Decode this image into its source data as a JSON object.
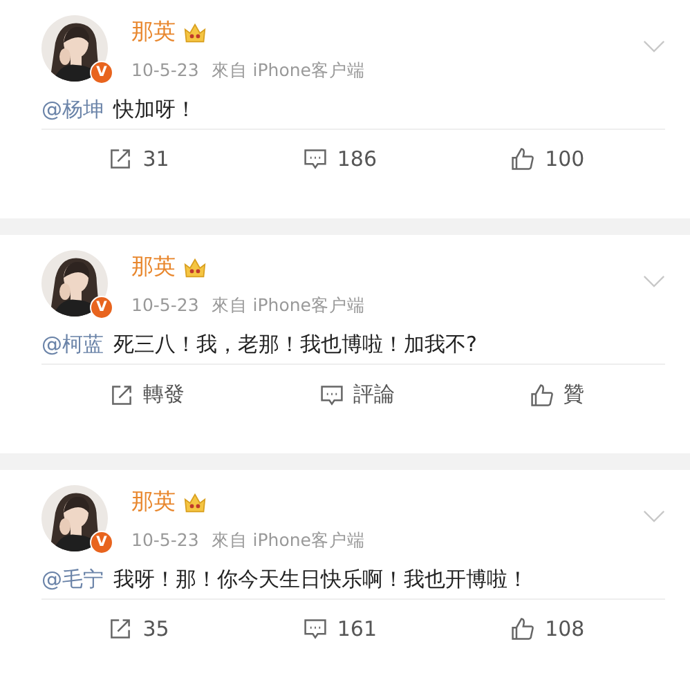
{
  "posts": [
    {
      "author": "那英",
      "verified_badge": "V",
      "time": "10-5-23",
      "source": "來自 iPhone客户端",
      "mention": "@杨坤",
      "text": "快加呀！",
      "actions": [
        {
          "kind": "share",
          "label": "31"
        },
        {
          "kind": "comment",
          "label": "186"
        },
        {
          "kind": "like",
          "label": "100"
        }
      ]
    },
    {
      "author": "那英",
      "verified_badge": "V",
      "time": "10-5-23",
      "source": "來自 iPhone客户端",
      "mention": "@柯蓝",
      "text": "死三八！我，老那！我也博啦！加我不?",
      "actions": [
        {
          "kind": "share",
          "label": "轉發"
        },
        {
          "kind": "comment",
          "label": "評論"
        },
        {
          "kind": "like",
          "label": "贊"
        }
      ]
    },
    {
      "author": "那英",
      "verified_badge": "V",
      "time": "10-5-23",
      "source": "來自 iPhone客户端",
      "mention": "@毛宁",
      "text": "我呀！那！你今天生日快乐啊！我也开博啦！",
      "actions": [
        {
          "kind": "share",
          "label": "35"
        },
        {
          "kind": "comment",
          "label": "161"
        },
        {
          "kind": "like",
          "label": "108"
        }
      ]
    }
  ]
}
